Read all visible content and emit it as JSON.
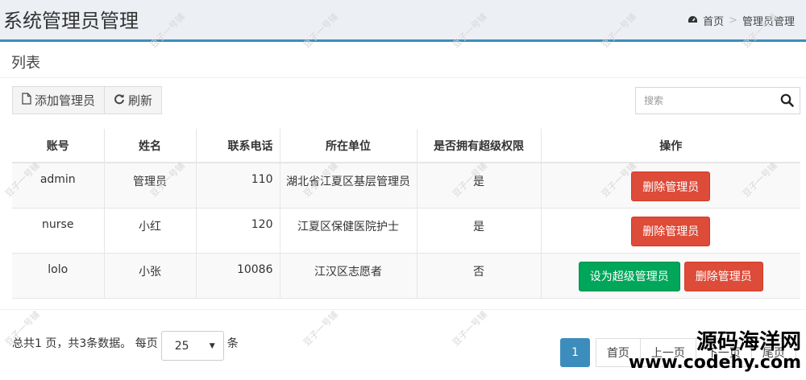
{
  "header": {
    "title": "系统管理员管理"
  },
  "breadcrumb": {
    "home_icon": "dashboard-icon",
    "home": "首页",
    "sep": ">",
    "current": "管理员管理"
  },
  "box": {
    "title": "列表"
  },
  "toolbar": {
    "add_label": "添加管理员",
    "add_icon": "file-icon",
    "refresh_label": "刷新",
    "refresh_icon": "refresh-icon"
  },
  "search": {
    "placeholder": "搜索",
    "icon": "search-icon"
  },
  "table": {
    "headers": [
      "账号",
      "姓名",
      "联系电话",
      "所在单位",
      "是否拥有超级权限",
      "操作"
    ],
    "rows": [
      {
        "account": "admin",
        "name": "管理员",
        "phone": "110",
        "unit": "湖北省江夏区基层管理员",
        "super": "是",
        "actions": [
          "删除管理员"
        ]
      },
      {
        "account": "nurse",
        "name": "小红",
        "phone": "120",
        "unit": "江夏区保健医院护士",
        "super": "是",
        "actions": [
          "删除管理员"
        ]
      },
      {
        "account": "lolo",
        "name": "小张",
        "phone": "10086",
        "unit": "江汉区志愿者",
        "super": "否",
        "actions": [
          "设为超级管理员",
          "删除管理员"
        ]
      }
    ]
  },
  "pager": {
    "summary": "总共1 页，共3条数据。 每页",
    "page_size": "25",
    "unit": "条",
    "current": "1",
    "buttons": [
      "首页",
      "上一页",
      "下一页",
      "尾页"
    ]
  },
  "watermark": {
    "text": "豆子一号铺"
  },
  "brand": {
    "line1": "源码海洋网",
    "line2": "www.codehy.com"
  },
  "colors": {
    "primary": "#3c8dbc",
    "danger": "#dd4b39",
    "success": "#00a65a",
    "header_bg": "#ecf0f5"
  }
}
